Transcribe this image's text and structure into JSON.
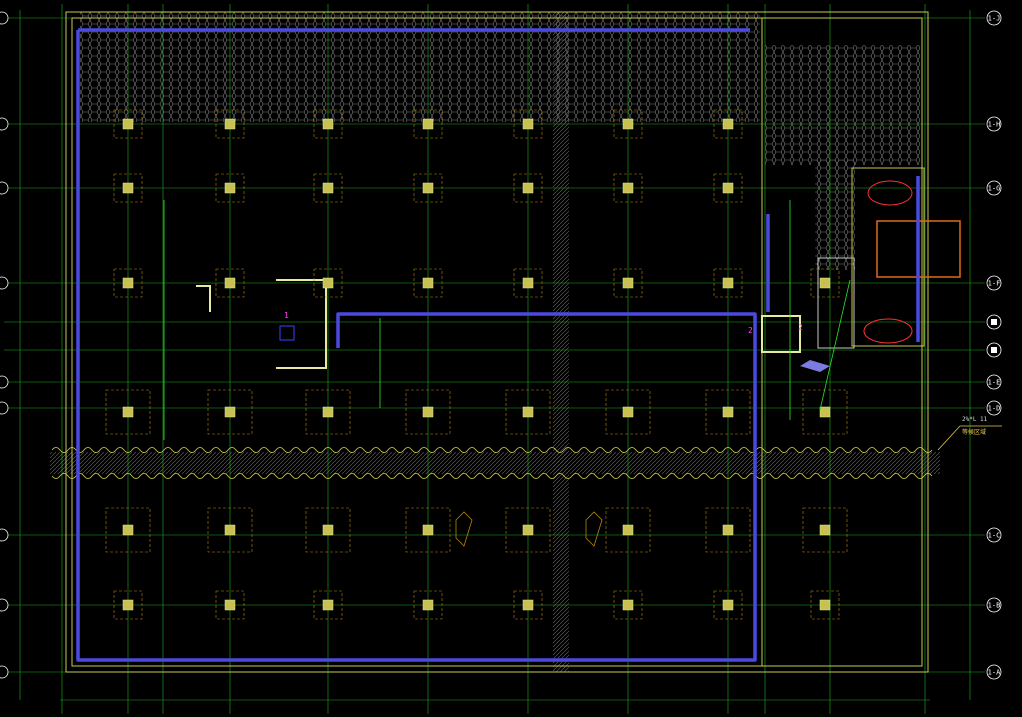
{
  "drawing": {
    "right_axes": [
      "1-J",
      "1-H",
      "1-G",
      "1-F",
      "1-E",
      "1-D",
      "1-C",
      "1-B",
      "1-A"
    ],
    "right_axes_boxed": [
      "",
      ""
    ],
    "callout": {
      "line1": "2%*L 11",
      "line2": "等候区域"
    },
    "section_marks": [
      "1",
      "2",
      "2"
    ],
    "colors": {
      "background": "#000000",
      "grid": "#19b219",
      "frame": "#c8c850",
      "footing": "#b8860b",
      "pipe": "#4a4ae0",
      "hatch": "#8a8a8a",
      "highlight": "#e06a1a"
    }
  }
}
